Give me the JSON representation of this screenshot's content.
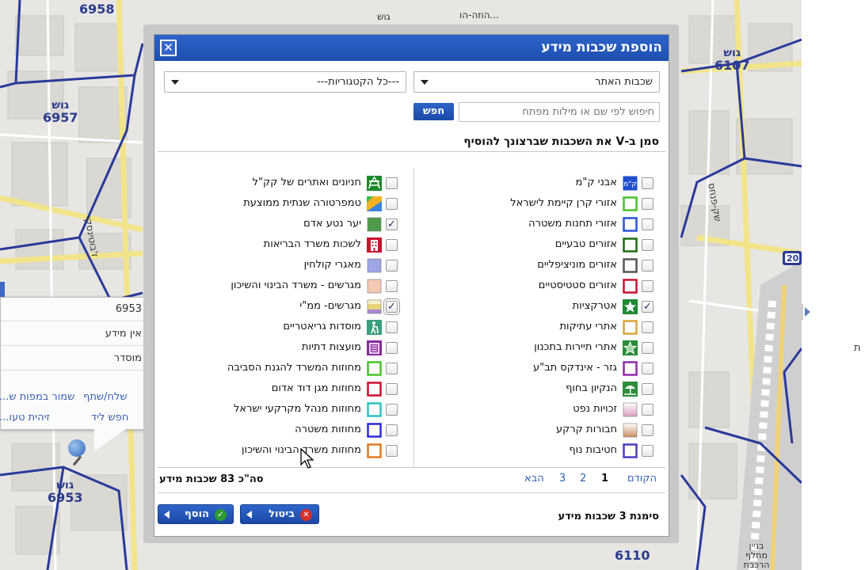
{
  "map": {
    "blocks": [
      {
        "label": "גוש",
        "number": "6958"
      },
      {
        "label": "גוש",
        "number": "6957"
      },
      {
        "label": "גוש",
        "number": "6107"
      },
      {
        "label": "גוש",
        "number": "6953"
      },
      {
        "label": "גוש",
        "number": "6110"
      }
    ],
    "streets": [
      "גוש",
      "הוזה-הו...",
      "שק-פנחס",
      "ז'בוטינסקי",
      "בניין מחלף הרכבת"
    ],
    "road_number": "20"
  },
  "info_popup": {
    "rows": [
      "6953",
      "אין מידע",
      "מוסדר"
    ],
    "links": [
      "שלח/שתף",
      "שמור במפות ש...",
      "חפש ליד",
      "זיהית טעו..."
    ]
  },
  "dialog": {
    "title": "הוספת שכבות מידע",
    "close_icon": "close-icon",
    "source_select": "שכבות האתר",
    "category_select": "---כל הקטגוריות---",
    "search_placeholder": "חיפוש לפי שם או מילות מפתח",
    "search_button": "חפש",
    "instruction": "סמן ב-V את השכבות שברצונך להוסיף",
    "right_column": [
      {
        "label": "אבני ק\"מ",
        "checked": false,
        "icon": "km-stone-icon",
        "color": "#1f4fcf"
      },
      {
        "label": "אזורי קרן קיימת לישראל",
        "checked": false,
        "icon": "outline-square-icon",
        "color": "#47c22a"
      },
      {
        "label": "אזורי תחנות משטרה",
        "checked": false,
        "icon": "outline-square-icon",
        "color": "#2a52d8"
      },
      {
        "label": "אזורים טבעיים",
        "checked": false,
        "icon": "outline-square-icon",
        "color": "#1b6a12"
      },
      {
        "label": "אזורים מוניציפליים",
        "checked": false,
        "icon": "outline-square-icon",
        "color": "#555555"
      },
      {
        "label": "אזורים סטטיסטיים",
        "checked": false,
        "icon": "outline-square-icon",
        "color": "#c8102e"
      },
      {
        "label": "אטרקציות",
        "checked": true,
        "icon": "star-icon",
        "color": "#1f8a35"
      },
      {
        "label": "אתרי עתיקות",
        "checked": false,
        "icon": "outline-square-icon",
        "color": "#d9a53b"
      },
      {
        "label": "אתרי תיירות בתכנון",
        "checked": false,
        "icon": "star-outline-icon",
        "color": "#2a8a3a"
      },
      {
        "label": "גזר - אינדקס תב\"ע",
        "checked": false,
        "icon": "outline-square-icon",
        "color": "#8e2aa8"
      },
      {
        "label": "הנקיון בחוף",
        "checked": false,
        "icon": "beach-icon",
        "color": "#2f8c3b"
      },
      {
        "label": "זכויות נפט",
        "checked": false,
        "icon": "gradient-square-icon",
        "color": "#d9a0c0"
      },
      {
        "label": "חבורות קרקע",
        "checked": false,
        "icon": "gradient-square-icon",
        "color": "#c98f63"
      },
      {
        "label": "חטיבות נוף",
        "checked": false,
        "icon": "outline-square-icon",
        "color": "#4a3fbf"
      }
    ],
    "left_column": [
      {
        "label": "חניונים ואתרים של קק\"ל",
        "checked": false,
        "icon": "picnic-icon",
        "color": "#1d8a2a"
      },
      {
        "label": "טמפרטורה שנתית ממוצעת",
        "checked": false,
        "icon": "temperature-icon",
        "color": "#e0a020"
      },
      {
        "label": "יער נטע אדם",
        "checked": true,
        "icon": "filled-square-icon",
        "color": "#4f9a4a"
      },
      {
        "label": "לשכות משרד הבריאות",
        "checked": false,
        "icon": "building-icon",
        "color": "#c8102e"
      },
      {
        "label": "מאגרי קולחין",
        "checked": false,
        "icon": "filled-square-icon",
        "color": "#9ea6e6"
      },
      {
        "label": "מגרשים - משרד הבינוי והשיכון",
        "checked": false,
        "icon": "filled-square-icon",
        "color": "#f3c9b3"
      },
      {
        "label": "מגרשים- ממ\"י",
        "checked": true,
        "icon": "striped-square-icon",
        "color": "#e8d27a",
        "focused": true
      },
      {
        "label": "מוסדות גריאטריים",
        "checked": false,
        "icon": "elderly-icon",
        "color": "#3aa07a"
      },
      {
        "label": "מועצות דתיות",
        "checked": false,
        "icon": "religious-icon",
        "color": "#8a2aa0"
      },
      {
        "label": "מחוזות המשרד להגנת הסביבה",
        "checked": false,
        "icon": "outline-square-icon",
        "color": "#47c22a"
      },
      {
        "label": "מחוזות מגן דוד אדום",
        "checked": false,
        "icon": "outline-square-icon",
        "color": "#c8102e"
      },
      {
        "label": "מחוזות מנהל מקרקעי ישראל",
        "checked": false,
        "icon": "outline-square-icon",
        "color": "#2bc2c2"
      },
      {
        "label": "מחוזות משטרה",
        "checked": false,
        "icon": "outline-square-icon",
        "color": "#2a2ad8"
      },
      {
        "label": "מחוזות משרד הבינוי והשיכון",
        "checked": false,
        "icon": "outline-square-icon",
        "color": "#e07a1f"
      }
    ],
    "pager": {
      "prev": "הקודם",
      "pages": [
        "1",
        "2",
        "3"
      ],
      "current": "1",
      "next": "הבא"
    },
    "total": "סה\"כ 83 שכבות מידע",
    "selected_count": "סימנת 3 שכבות מידע",
    "cancel_button": "ביטול",
    "add_button": "הוסף",
    "accent": "#2160c4"
  }
}
